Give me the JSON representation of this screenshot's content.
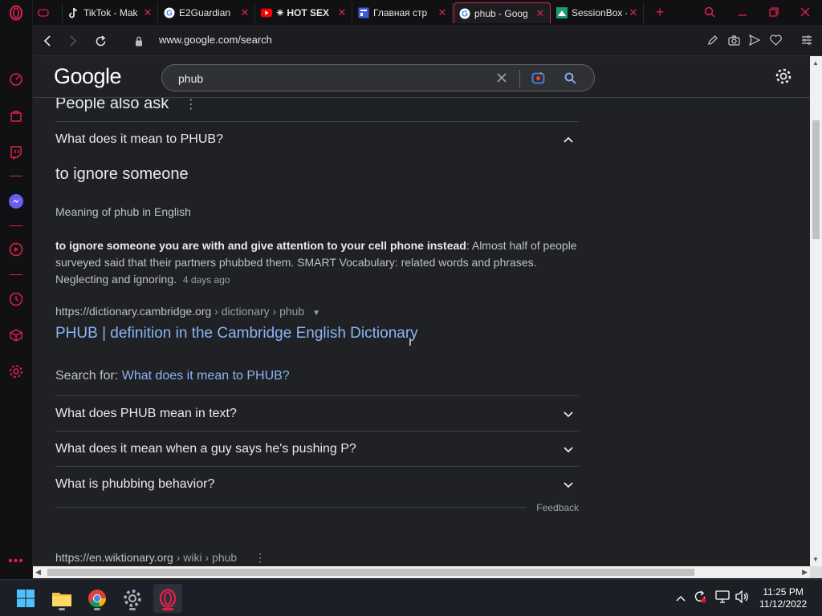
{
  "tabs": [
    {
      "title": "",
      "favicon": "opera-gx-gamepad-icon"
    },
    {
      "title": "TikTok - Mak",
      "favicon": "tiktok-icon"
    },
    {
      "title": "E2Guardian",
      "favicon": "google-g-icon"
    },
    {
      "title": "✴ HOT SEX",
      "favicon": "youtube-icon"
    },
    {
      "title": "Главная стр",
      "favicon": "site-icon"
    },
    {
      "title": "phub - Goog",
      "favicon": "google-g-icon",
      "active": true
    },
    {
      "title": "SessionBox -",
      "favicon": "sessionbox-icon"
    }
  ],
  "address": {
    "url": "www.google.com/search"
  },
  "google": {
    "logo": "Google",
    "query": "phub"
  },
  "paa": {
    "title": "People also ask",
    "expanded": {
      "question": "What does it mean to PHUB?",
      "headline": "to ignore someone",
      "meaning": "Meaning of phub in English",
      "bold": "to ignore someone you are with and give attention to your cell phone instead",
      "rest1": ": Almost half of people",
      "line2": "surveyed said that their partners phubbed them. SMART Vocabulary: related words and phrases.",
      "line3": "Neglecting and ignoring.",
      "age": "4 days ago",
      "cite_domain": "https://dictionary.cambridge.org",
      "cite_path": " › dictionary › phub",
      "link": "PHUB | definition in the Cambridge English Dictionary",
      "search_for_label": "Search for:",
      "search_for_link": "What does it mean to PHUB?"
    },
    "questions": [
      "What does PHUB mean in text?",
      "What does it mean when a guy says he's pushing P?",
      "What is phubbing behavior?"
    ],
    "feedback": "Feedback"
  },
  "next_result": {
    "cite_domain": "https://en.wiktionary.org",
    "cite_path": " › wiki › phub"
  },
  "taskbar": {
    "time": "11:25 PM",
    "date": "11/12/2022"
  },
  "colors": {
    "opera_accent": "#e0204a",
    "google_link": "#8ab4f8",
    "page_bg": "#202124"
  }
}
